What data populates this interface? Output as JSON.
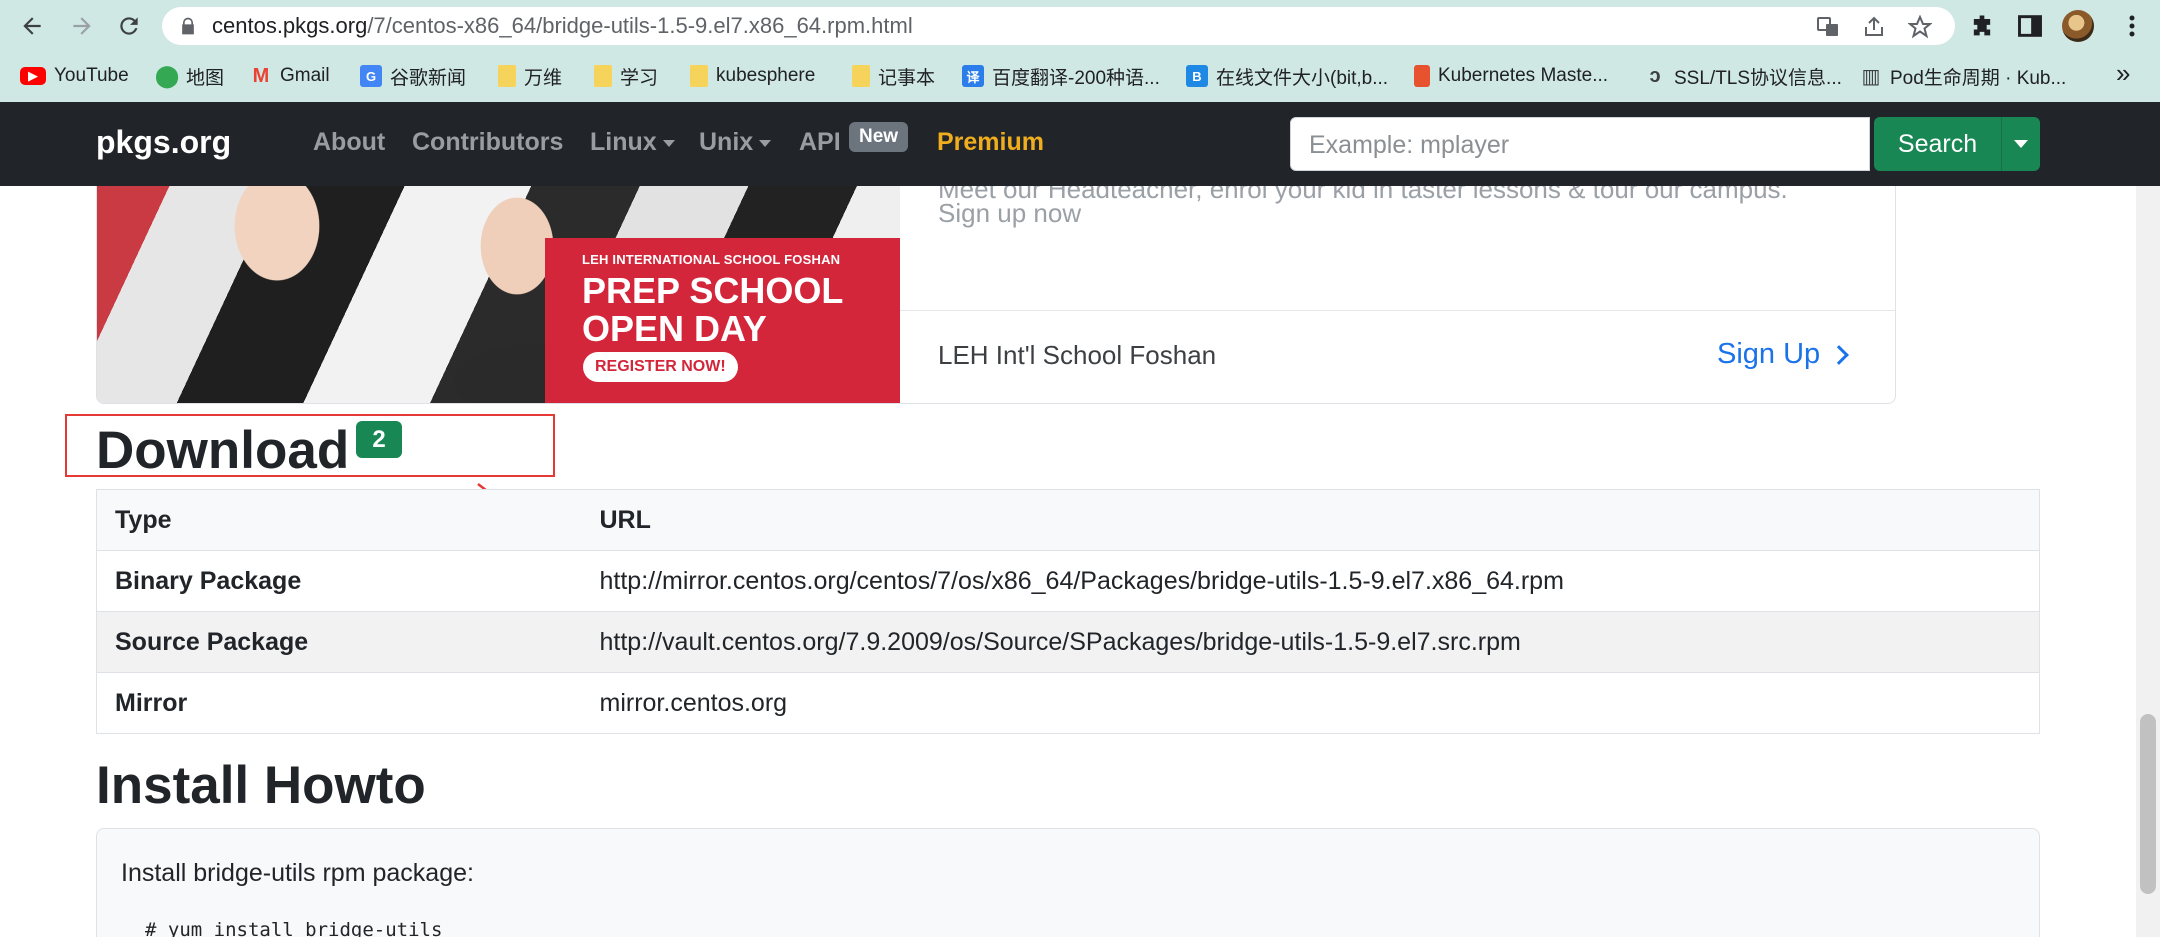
{
  "browser": {
    "url_host": "centos.pkgs.org",
    "url_path": "/7/centos-x86_64/bridge-utils-1.5-9.el7.x86_64.rpm.html",
    "bookmarks": [
      {
        "label": "YouTube",
        "icon": "youtube-icon"
      },
      {
        "label": "地图",
        "icon": "maps-icon"
      },
      {
        "label": "Gmail",
        "icon": "gmail-icon"
      },
      {
        "label": "谷歌新闻",
        "icon": "google-news-icon"
      },
      {
        "label": "万维",
        "icon": "folder-icon"
      },
      {
        "label": "学习",
        "icon": "folder-icon"
      },
      {
        "label": "kubesphere",
        "icon": "folder-icon"
      },
      {
        "label": "记事本",
        "icon": "folder-icon"
      },
      {
        "label": "百度翻译-200种语...",
        "icon": "translate-icon"
      },
      {
        "label": "在线文件大小(bit,b...",
        "icon": "b-icon"
      },
      {
        "label": "Kubernetes Maste...",
        "icon": "kubernetes-icon"
      },
      {
        "label": "SSL/TLS协议信息...",
        "icon": "ssl-icon"
      },
      {
        "label": "Pod生命周期 · Kub...",
        "icon": "book-icon"
      }
    ]
  },
  "site": {
    "brand": "pkgs.org",
    "nav": {
      "about": "About",
      "contributors": "Contributors",
      "linux": "Linux",
      "unix": "Unix",
      "api": "API",
      "api_badge": "New",
      "premium": "Premium"
    },
    "search": {
      "placeholder": "Example: mplayer",
      "button": "Search"
    }
  },
  "ad": {
    "school_name": "LEH INTERNATIONAL SCHOOL FOSHAN",
    "headline_line1": "PREP SCHOOL",
    "headline_line2": "OPEN DAY",
    "register": "REGISTER NOW!",
    "body_partial": "Meet our Headteacher, enrol your kid in taster lessons & tour our campus.",
    "body_line2": "Sign up now",
    "advertiser": "LEH Int'l School Foshan",
    "cta": "Sign Up"
  },
  "download": {
    "title": "Download",
    "count": "2",
    "headers": {
      "type": "Type",
      "url": "URL"
    },
    "rows": [
      {
        "type": "Binary Package",
        "url": "http://mirror.centos.org/centos/7/os/x86_64/Packages/bridge-utils-1.5-9.el7.x86_64.rpm"
      },
      {
        "type": "Source Package",
        "url": "http://vault.centos.org/7.9.2009/os/Source/SPackages/bridge-utils-1.5-9.el7.src.rpm"
      },
      {
        "type": "Mirror",
        "url": "mirror.centos.org"
      }
    ]
  },
  "install": {
    "title": "Install Howto",
    "description": "Install bridge-utils rpm package:",
    "command": "# yum install bridge-utils"
  },
  "colors": {
    "chrome_bg": "#cfe8e3",
    "navbar_bg": "#212529",
    "accent_green": "#198754",
    "premium_gold": "#f0ad1e",
    "annotation_red": "#e53935",
    "link_blue": "#1a73e8"
  }
}
